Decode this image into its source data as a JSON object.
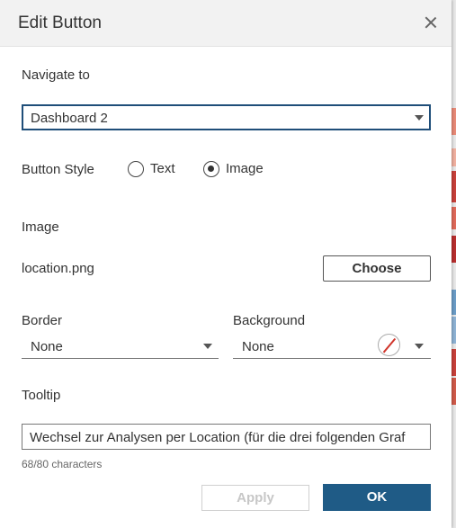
{
  "dialog": {
    "title": "Edit Button",
    "navigate": {
      "label": "Navigate to",
      "value": "Dashboard 2"
    },
    "button_style": {
      "label": "Button Style",
      "options": [
        {
          "label": "Text",
          "selected": false
        },
        {
          "label": "Image",
          "selected": true
        }
      ]
    },
    "image": {
      "label": "Image",
      "file": "location.png",
      "choose_label": "Choose"
    },
    "border": {
      "label": "Border",
      "value": "None"
    },
    "background": {
      "label": "Background",
      "value": "None"
    },
    "tooltip": {
      "label": "Tooltip",
      "value": "Wechsel zur Analysen per Location (für die drei folgenden Graf",
      "char_count": "68/80 characters"
    },
    "buttons": {
      "apply": "Apply",
      "ok": "OK"
    }
  },
  "colors": {
    "accent": "#1f5b86",
    "focus_border": "#1f4e79",
    "swatch_slash": "#d0352b"
  }
}
